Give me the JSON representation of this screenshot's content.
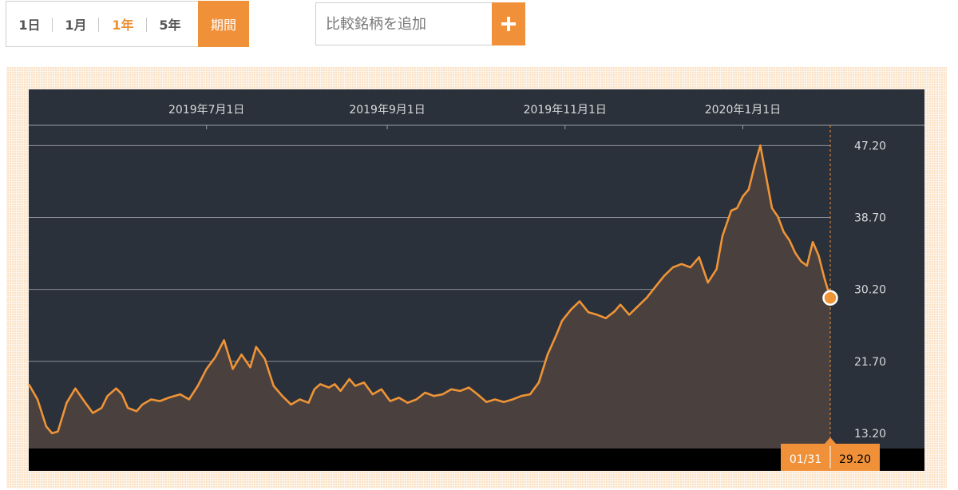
{
  "toolbar": {
    "ranges": [
      {
        "label": "1日",
        "active": false
      },
      {
        "label": "1月",
        "active": false
      },
      {
        "label": "1年",
        "active": true
      },
      {
        "label": "5年",
        "active": false
      }
    ],
    "period_label": "期間",
    "compare_placeholder": "比較銘柄を追加",
    "add_icon": "plus-icon"
  },
  "colors": {
    "accent": "#f0913a",
    "plot_bg": "#2b313a",
    "area_fill": "#4a403e",
    "line": "#ef9437"
  },
  "chart_data": {
    "type": "area",
    "x_tick_labels": [
      "2019年7月1日",
      "2019年9月1日",
      "2019年11月1日",
      "2020年1月1日"
    ],
    "x_tick_dates": [
      "2019-07-01",
      "2019-09-01",
      "2019-11-01",
      "2020-01-01"
    ],
    "y_ticks": [
      13.2,
      21.7,
      30.2,
      38.7,
      47.2
    ],
    "y_tick_labels": [
      "13.20",
      "21.70",
      "30.20",
      "38.70",
      "47.20"
    ],
    "x_range": [
      "2019-05-01",
      "2020-01-31"
    ],
    "ylim": [
      11.4,
      49.4
    ],
    "grid": true,
    "last_point": {
      "date_label": "01/31",
      "value_label": "29.20",
      "value": 29.2
    },
    "series": [
      {
        "x": [
          "2019-05-01",
          "2019-05-04",
          "2019-05-07",
          "2019-05-09",
          "2019-05-11",
          "2019-05-14",
          "2019-05-17",
          "2019-05-20",
          "2019-05-23",
          "2019-05-26",
          "2019-05-28",
          "2019-05-31",
          "2019-06-02",
          "2019-06-04",
          "2019-06-07",
          "2019-06-09",
          "2019-06-12",
          "2019-06-15",
          "2019-06-18",
          "2019-06-20",
          "2019-06-22",
          "2019-06-25",
          "2019-06-28",
          "2019-07-01",
          "2019-07-04",
          "2019-07-07",
          "2019-07-10",
          "2019-07-13",
          "2019-07-16",
          "2019-07-18",
          "2019-07-21",
          "2019-07-24",
          "2019-07-27",
          "2019-07-30",
          "2019-08-02",
          "2019-08-05",
          "2019-08-07",
          "2019-08-09",
          "2019-08-12",
          "2019-08-14",
          "2019-08-16",
          "2019-08-19",
          "2019-08-21",
          "2019-08-24",
          "2019-08-27",
          "2019-08-30",
          "2019-09-02",
          "2019-09-05",
          "2019-09-08",
          "2019-09-11",
          "2019-09-14",
          "2019-09-17",
          "2019-09-20",
          "2019-09-23",
          "2019-09-26",
          "2019-09-29",
          "2019-10-02",
          "2019-10-05",
          "2019-10-08",
          "2019-10-11",
          "2019-10-14",
          "2019-10-17",
          "2019-10-20",
          "2019-10-23",
          "2019-10-26",
          "2019-10-29",
          "2019-10-31",
          "2019-11-03",
          "2019-11-06",
          "2019-11-09",
          "2019-11-12",
          "2019-11-15",
          "2019-11-18",
          "2019-11-20",
          "2019-11-23",
          "2019-11-26",
          "2019-11-29",
          "2019-12-02",
          "2019-12-05",
          "2019-12-08",
          "2019-12-11",
          "2019-12-14",
          "2019-12-17",
          "2019-12-20",
          "2019-12-23",
          "2019-12-25",
          "2019-12-28",
          "2019-12-30",
          "2020-01-01",
          "2020-01-03",
          "2020-01-05",
          "2020-01-07",
          "2020-01-09",
          "2020-01-11",
          "2020-01-13",
          "2020-01-15",
          "2020-01-17",
          "2020-01-19",
          "2020-01-21",
          "2020-01-23",
          "2020-01-25",
          "2020-01-27",
          "2020-01-29",
          "2020-01-31"
        ],
        "values": [
          19.0,
          17.2,
          14.0,
          13.2,
          13.4,
          16.8,
          18.5,
          17.0,
          15.6,
          16.2,
          17.6,
          18.5,
          17.8,
          16.2,
          15.8,
          16.6,
          17.2,
          17.0,
          17.4,
          17.6,
          17.8,
          17.2,
          18.8,
          20.8,
          22.2,
          24.2,
          20.8,
          22.5,
          21.0,
          23.4,
          22.0,
          18.8,
          17.6,
          16.6,
          17.2,
          16.8,
          18.4,
          19.0,
          18.6,
          19.0,
          18.2,
          19.6,
          18.8,
          19.2,
          17.8,
          18.4,
          17.0,
          17.4,
          16.8,
          17.2,
          18.0,
          17.6,
          17.8,
          18.4,
          18.2,
          18.6,
          17.8,
          16.9,
          17.2,
          16.9,
          17.2,
          17.6,
          17.8,
          19.2,
          22.5,
          24.8,
          26.5,
          27.8,
          28.8,
          27.5,
          27.2,
          26.8,
          27.6,
          28.4,
          27.2,
          28.2,
          29.2,
          30.5,
          31.8,
          32.8,
          33.2,
          32.8,
          34.0,
          31.0,
          32.6,
          36.5,
          39.5,
          39.8,
          41.2,
          42.0,
          44.8,
          47.2,
          43.5,
          39.8,
          38.8,
          37.0,
          36.0,
          34.5,
          33.5,
          33.0,
          35.8,
          34.2,
          31.5,
          29.2
        ]
      }
    ]
  }
}
